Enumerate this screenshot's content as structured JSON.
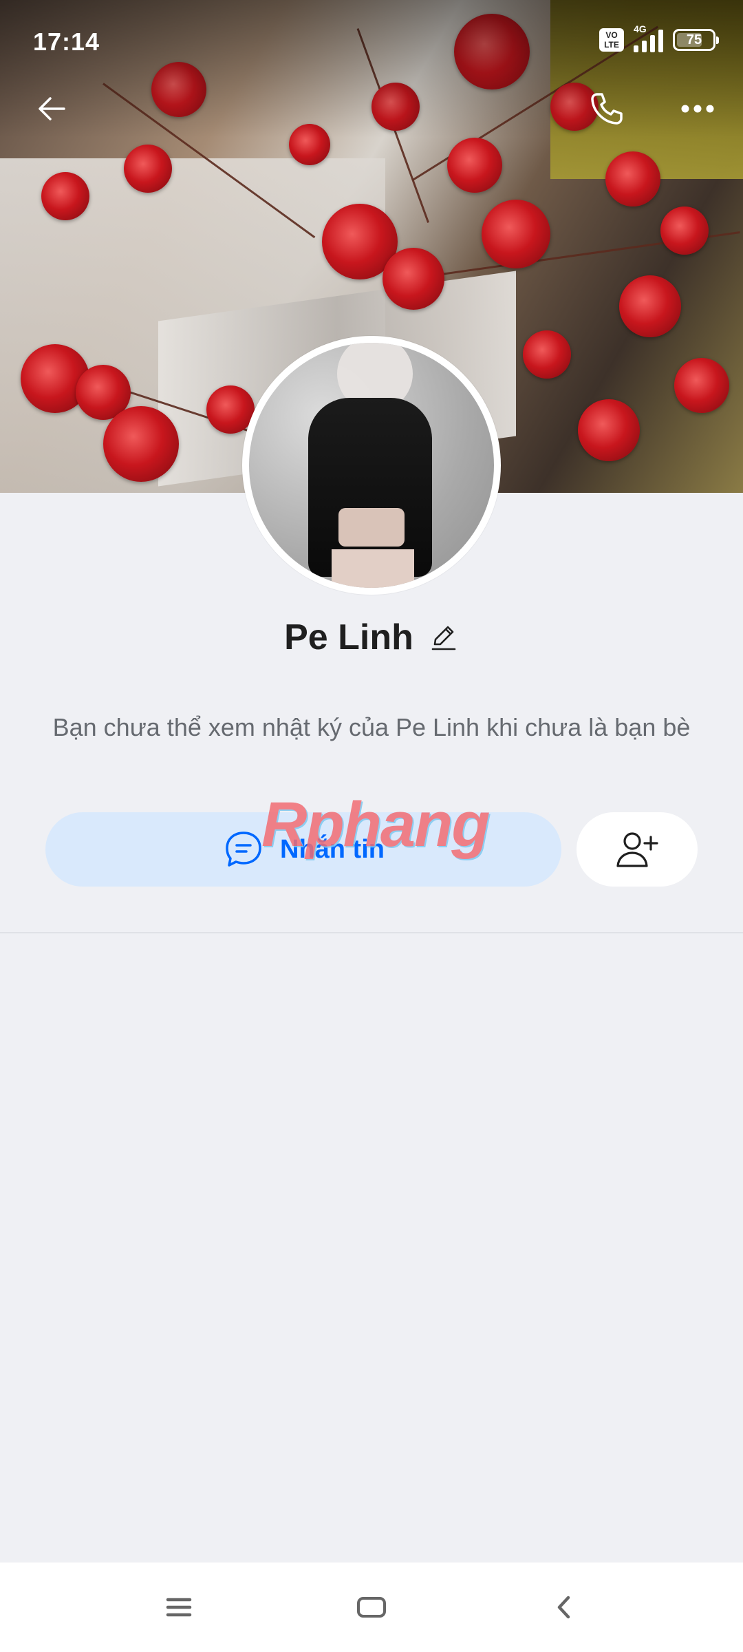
{
  "status_bar": {
    "time": "17:14",
    "volte_label": "VO LTE",
    "network": "4G",
    "battery": "75",
    "battery_level": 0.75
  },
  "header": {
    "back_icon": "arrow-left-icon",
    "call_icon": "phone-icon",
    "more_icon": "more-dots-icon"
  },
  "profile": {
    "name": "Pe Linh",
    "edit_icon": "pencil-icon",
    "info_text": "Bạn chưa thể xem nhật ký của Pe Linh khi chưa là bạn bè"
  },
  "actions": {
    "message_label": "Nhắn tin",
    "message_icon": "chat-bubble-icon",
    "add_friend_icon": "add-user-icon"
  },
  "watermark": {
    "text": "Rphang"
  },
  "nav": {
    "menu_icon": "menu-icon",
    "home_icon": "home-icon",
    "back_icon": "chevron-left-icon"
  },
  "colors": {
    "accent": "#0068ff",
    "message_button_bg": "#d9e9fc",
    "background": "#eff0f4"
  }
}
